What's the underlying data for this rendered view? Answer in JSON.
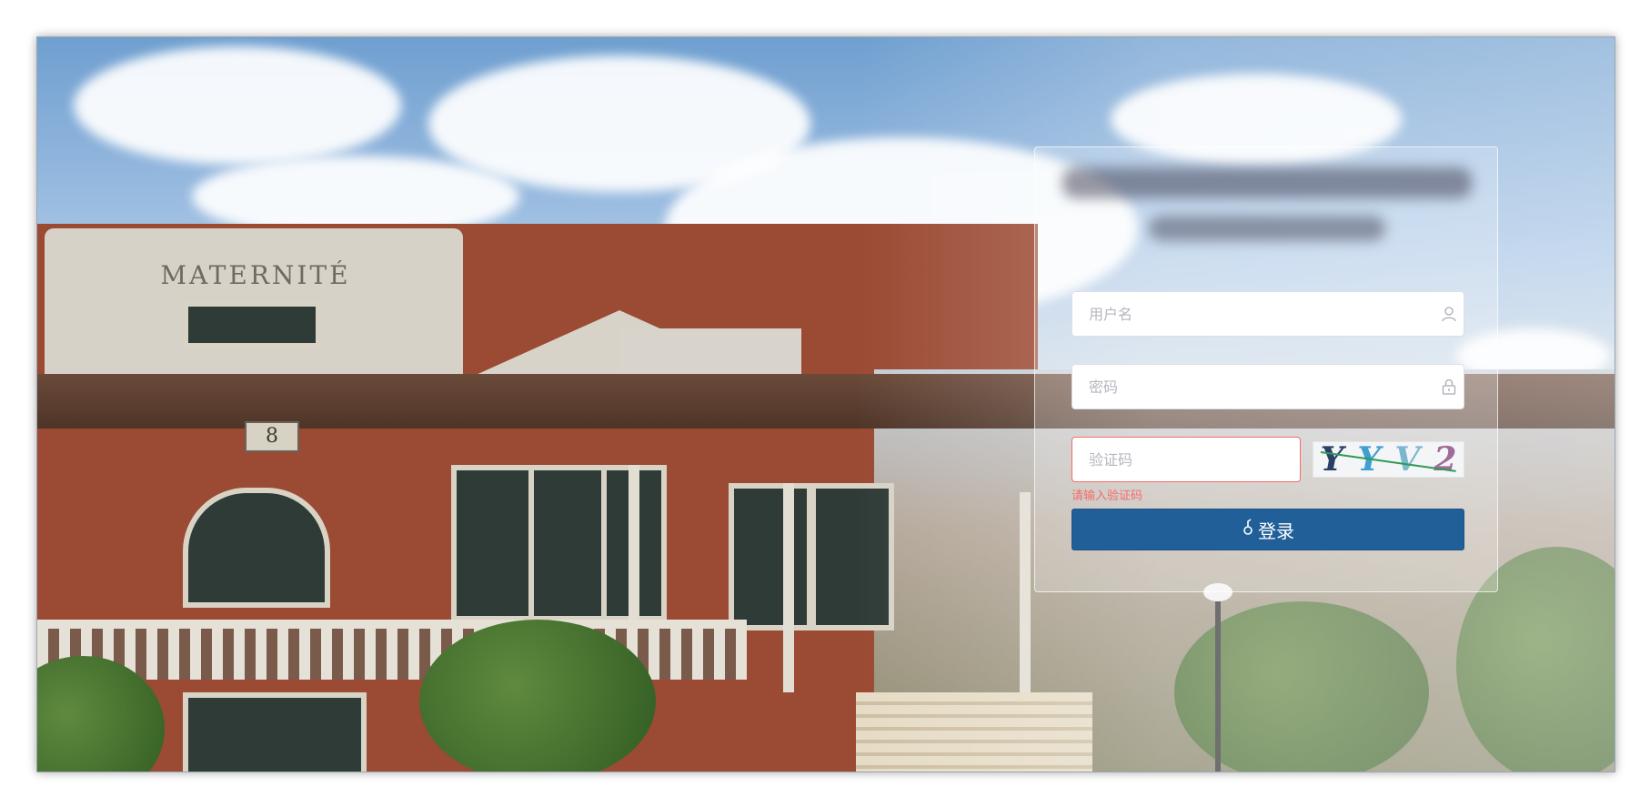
{
  "login": {
    "username_placeholder": "用户名",
    "password_placeholder": "密码",
    "captcha_placeholder": "验证码",
    "captcha_chars": [
      "Y",
      "Y",
      "V",
      "2"
    ],
    "captcha_colors": [
      "#2a3f66",
      "#3f9fd0",
      "#7bb8cf",
      "#a06a9a"
    ],
    "error_message": "请输入验证码",
    "submit_label": "登录",
    "submit_icon": "key-icon"
  },
  "background": {
    "facade_text": "MATERNITÉ",
    "house_number": "8"
  },
  "colors": {
    "button": "#215f99",
    "error": "#f56c6c",
    "placeholder": "#b4b7be"
  }
}
